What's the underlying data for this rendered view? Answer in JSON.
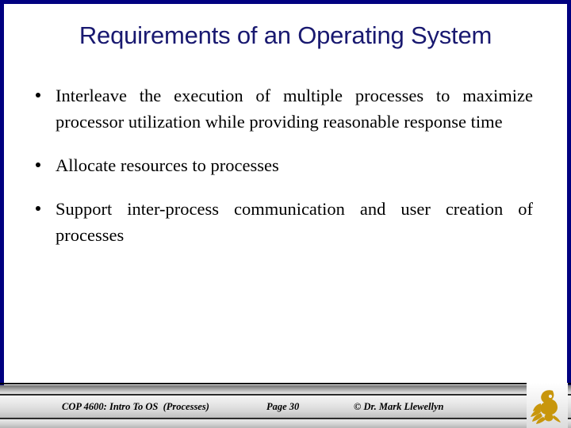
{
  "slide": {
    "title": "Requirements of an Operating System",
    "background_color": "#ffffff",
    "border_color": "#000080",
    "title_color": "#191970",
    "body": {
      "bullets": [
        "Interleave the execution of multiple processes to maximize processor utilization while providing reasonable response time",
        "Allocate resources to processes",
        "Support inter-process communication and user creation of processes"
      ]
    },
    "footer": {
      "course": "COP 4600: Intro To OS  (Processes)",
      "page": "Page 30",
      "copyright": "© Dr. Mark Llewellyn",
      "logo_name": "ucf-pegasus-logo",
      "logo_color": "#C8960C"
    }
  }
}
